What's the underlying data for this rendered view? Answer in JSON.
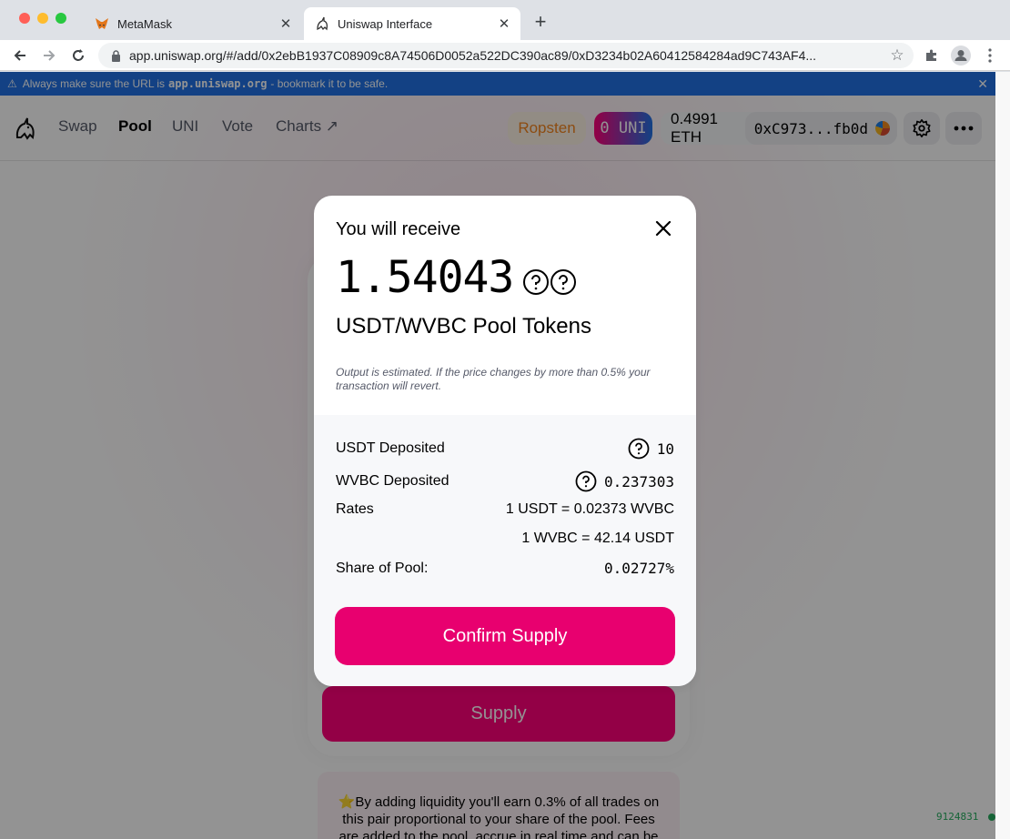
{
  "browser": {
    "tabs": [
      {
        "title": "MetaMask",
        "icon": "fox-icon",
        "active": false
      },
      {
        "title": "Uniswap Interface",
        "icon": "unicorn-icon",
        "active": true
      }
    ],
    "url": "app.uniswap.org/#/add/0x2ebB1937C08909c8A74506D0052a522DC390ac89/0xD3234b02A60412584284ad9C743AF4..."
  },
  "banner": {
    "prefix": "Always make sure the URL is",
    "domain": "app.uniswap.org",
    "suffix": "- bookmark it to be safe."
  },
  "header": {
    "nav": [
      "Swap",
      "Pool",
      "UNI",
      "Vote",
      "Charts ↗"
    ],
    "active_nav": "Pool",
    "network": "Ropsten",
    "uni_balance": "0 UNI",
    "eth_balance": "0.4991 ETH",
    "address": "0xC973...fb0d"
  },
  "background": {
    "supply_label": "Supply",
    "info_text": "⭐️By adding liquidity you'll earn 0.3% of all trades on this pair proportional to your share of the pool. Fees are added to the pool, accrue in real time and can be",
    "block_number": "9124831"
  },
  "modal": {
    "title": "You will receive",
    "amount": "1.54043",
    "token_name": "USDT/WVBC Pool Tokens",
    "note": "Output is estimated. If the price changes by more than 0.5% your transaction will revert.",
    "rows": {
      "usdt_label": "USDT Deposited",
      "usdt_value": "10",
      "wvbc_label": "WVBC Deposited",
      "wvbc_value": "0.237303",
      "rates_label": "Rates",
      "rate1": "1 USDT = 0.02373 WVBC",
      "rate2": "1 WVBC = 42.14 USDT",
      "share_label": "Share of Pool:",
      "share_value": "0.02727%"
    },
    "confirm_label": "Confirm Supply"
  },
  "colors": {
    "accent": "#e8006f",
    "banner": "#2172e5",
    "network": "#f3841e"
  }
}
